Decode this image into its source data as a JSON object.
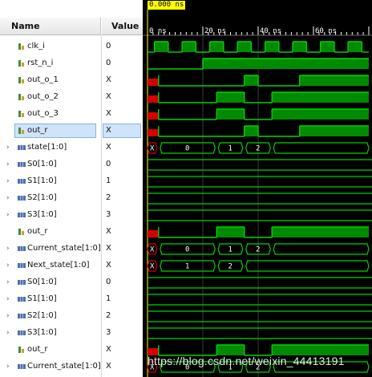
{
  "header": {
    "name_label": "Name",
    "value_label": "Value"
  },
  "cursor": {
    "time_label": "0.000 ns"
  },
  "ruler": {
    "ticks": [
      "0 ns",
      "20 ns",
      "40 ns",
      "60 ns"
    ]
  },
  "signals": [
    {
      "name": "clk_i",
      "value": "0",
      "kind": "bit",
      "expandable": false
    },
    {
      "name": "rst_n_i",
      "value": "0",
      "kind": "bit",
      "expandable": false
    },
    {
      "name": "out_o_1",
      "value": "X",
      "kind": "bit",
      "expandable": false
    },
    {
      "name": "out_o_2",
      "value": "X",
      "kind": "bit",
      "expandable": false
    },
    {
      "name": "out_o_3",
      "value": "X",
      "kind": "bit",
      "expandable": false
    },
    {
      "name": "out_r",
      "value": "X",
      "kind": "bit",
      "expandable": false,
      "selected": true
    },
    {
      "name": "state[1:0]",
      "value": "X",
      "kind": "bus",
      "expandable": true
    },
    {
      "name": "S0[1:0]",
      "value": "0",
      "kind": "bus",
      "expandable": true
    },
    {
      "name": "S1[1:0]",
      "value": "1",
      "kind": "bus",
      "expandable": true
    },
    {
      "name": "S2[1:0]",
      "value": "2",
      "kind": "bus",
      "expandable": true
    },
    {
      "name": "S3[1:0]",
      "value": "3",
      "kind": "bus",
      "expandable": true
    },
    {
      "name": "out_r",
      "value": "X",
      "kind": "bit",
      "expandable": false
    },
    {
      "name": "Current_state[1:0]",
      "value": "X",
      "kind": "bus",
      "expandable": true
    },
    {
      "name": "Next_state[1:0]",
      "value": "X",
      "kind": "bus",
      "expandable": true
    },
    {
      "name": "S0[1:0]",
      "value": "0",
      "kind": "bus",
      "expandable": true
    },
    {
      "name": "S1[1:0]",
      "value": "1",
      "kind": "bus",
      "expandable": true
    },
    {
      "name": "S2[1:0]",
      "value": "2",
      "kind": "bus",
      "expandable": true
    },
    {
      "name": "S3[1:0]",
      "value": "3",
      "kind": "bus",
      "expandable": true
    },
    {
      "name": "out_r",
      "value": "X",
      "kind": "bit",
      "expandable": false
    },
    {
      "name": "Current_state[1:0]",
      "value": "X",
      "kind": "bus",
      "expandable": true
    }
  ],
  "waveforms": {
    "time_range_ns": [
      0,
      80
    ],
    "clock_period_ns": 10,
    "bit_waves": {
      "clk_i": [
        [
          0,
          "0"
        ],
        [
          2.5,
          "1"
        ],
        [
          7.5,
          "0"
        ],
        [
          12.5,
          "1"
        ],
        [
          17.5,
          "0"
        ],
        [
          22.5,
          "1"
        ],
        [
          27.5,
          "0"
        ],
        [
          32.5,
          "1"
        ],
        [
          37.5,
          "0"
        ],
        [
          42.5,
          "1"
        ],
        [
          47.5,
          "0"
        ],
        [
          52.5,
          "1"
        ],
        [
          57.5,
          "0"
        ],
        [
          62.5,
          "1"
        ],
        [
          67.5,
          "0"
        ],
        [
          72.5,
          "1"
        ],
        [
          77.5,
          "0"
        ]
      ],
      "rst_n_i": [
        [
          0,
          "0"
        ],
        [
          20,
          "1"
        ]
      ],
      "out_o_1": [
        [
          0,
          "X"
        ],
        [
          4,
          "0"
        ],
        [
          35,
          "1"
        ],
        [
          40,
          "0"
        ],
        [
          55,
          "1"
        ]
      ],
      "out_o_2": [
        [
          0,
          "X"
        ],
        [
          4,
          "0"
        ],
        [
          25,
          "1"
        ],
        [
          35,
          "0"
        ],
        [
          45,
          "1"
        ]
      ],
      "out_o_3": [
        [
          0,
          "X"
        ],
        [
          4,
          "0"
        ],
        [
          25,
          "1"
        ],
        [
          35,
          "0"
        ],
        [
          45,
          "1"
        ]
      ],
      "out_r": [
        [
          0,
          "X"
        ],
        [
          4,
          "0"
        ],
        [
          35,
          "1"
        ],
        [
          40,
          "0"
        ],
        [
          55,
          "1"
        ]
      ],
      "out_r_2": [
        [
          0,
          "X"
        ],
        [
          4,
          "0"
        ],
        [
          25,
          "1"
        ],
        [
          35,
          "0"
        ],
        [
          45,
          "1"
        ]
      ],
      "out_r_3": [
        [
          0,
          "X"
        ],
        [
          4,
          "0"
        ],
        [
          25,
          "1"
        ],
        [
          35,
          "0"
        ],
        [
          45,
          "1"
        ]
      ]
    },
    "bus_waves": {
      "state": [
        [
          0,
          "X"
        ],
        [
          4,
          "0"
        ],
        [
          25,
          "1"
        ],
        [
          35,
          "2"
        ],
        [
          45,
          ""
        ]
      ],
      "current_state": [
        [
          0,
          "X"
        ],
        [
          4,
          "0"
        ],
        [
          25,
          "1"
        ],
        [
          35,
          "2"
        ],
        [
          45,
          ""
        ]
      ],
      "next_state": [
        [
          0,
          "X"
        ],
        [
          4,
          "1"
        ],
        [
          25,
          "2"
        ],
        [
          35,
          ""
        ]
      ],
      "current_state_2": [
        [
          0,
          "X"
        ],
        [
          4,
          "0"
        ],
        [
          25,
          "1"
        ],
        [
          35,
          "2"
        ],
        [
          45,
          ""
        ]
      ]
    }
  },
  "watermark": "https://blog.csdn.net/weixin_44413191",
  "colors": {
    "wave": "#00d400",
    "wave_high_fill": "#008a00",
    "x_state": "#d40000",
    "background": "#000000",
    "grid": "#3a3a3a"
  }
}
